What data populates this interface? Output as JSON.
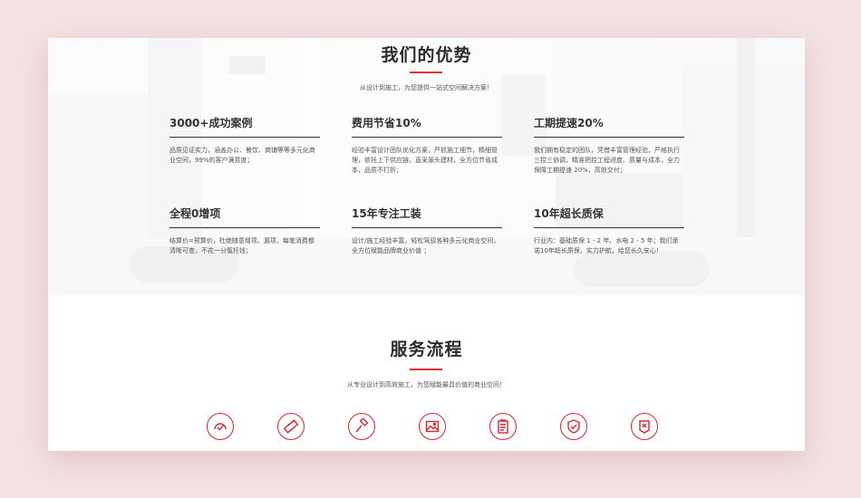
{
  "accent_color": "#d9262f",
  "advantages": {
    "title": "我们的优势",
    "subtitle": "从设计到施工，为您提供一站式空间解决方案！",
    "items": [
      {
        "title": "3000+成功案例",
        "desc": "品质见证实力，涵盖办公、餐饮、商铺等等多元化商业空间，99%的客户满意度；"
      },
      {
        "title": "费用节省10%",
        "desc": "经验丰富设计团队优化方案，严抓施工细节，精细管理，依托上下供应链，直采源头建材，全方位节省成本，品质不打折；"
      },
      {
        "title": "工期提速20%",
        "desc": "我们拥有稳定的团队，凭借丰富管理经验，严格执行三控三协调，精准把控工程进度、质量与成本，全力保障工期提速 20%，高效交付；"
      },
      {
        "title": "全程0增项",
        "desc": "结算价=预算价，杜绝随意增项、漏项，每笔消费都清晰可查，不花一分冤枉钱；"
      },
      {
        "title": "15年专注工装",
        "desc": "设计/施工经验丰富，轻松驾驭各种多元化商业空间，全方位赋能品牌商业价值 ；"
      },
      {
        "title": "10年超长质保",
        "desc": "行业内：基础质保 1 - 2 年、水电 2 - 5 年；我们承诺10年超长质保，实力护航，给您长久安心！"
      }
    ]
  },
  "service": {
    "title": "服务流程",
    "subtitle": "从专业设计到高效施工，为您赋能最具价值的商业空间！",
    "icons": [
      "speedometer-icon",
      "ruler-icon",
      "hammer-icon",
      "picture-icon",
      "document-icon",
      "shield-check-icon",
      "badge-icon"
    ]
  }
}
